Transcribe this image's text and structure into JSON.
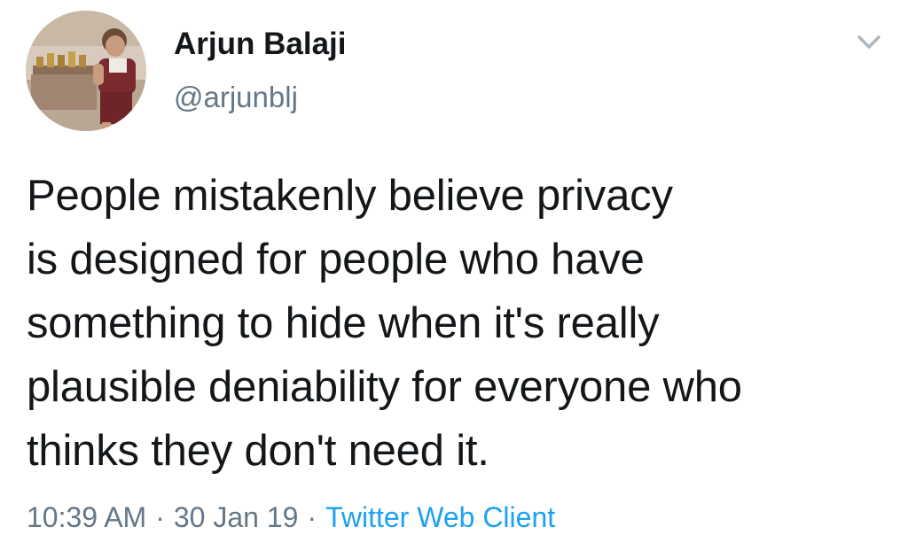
{
  "tweet": {
    "author": {
      "display_name": "Arjun Balaji",
      "handle": "@arjunblj"
    },
    "text": "People mistakenly believe privacy\nis designed for people who have\nsomething to hide when it's really\nplausible deniability for everyone who\nthinks they don't need it.",
    "time": "10:39 AM",
    "separator": "·",
    "date": "30 Jan 19",
    "client": "Twitter Web Client"
  },
  "icons": {
    "menu": "chevron-down-icon"
  },
  "colors": {
    "text": "#14171a",
    "secondary": "#657786",
    "link": "#1da1f2",
    "caret": "#aab8c2"
  }
}
